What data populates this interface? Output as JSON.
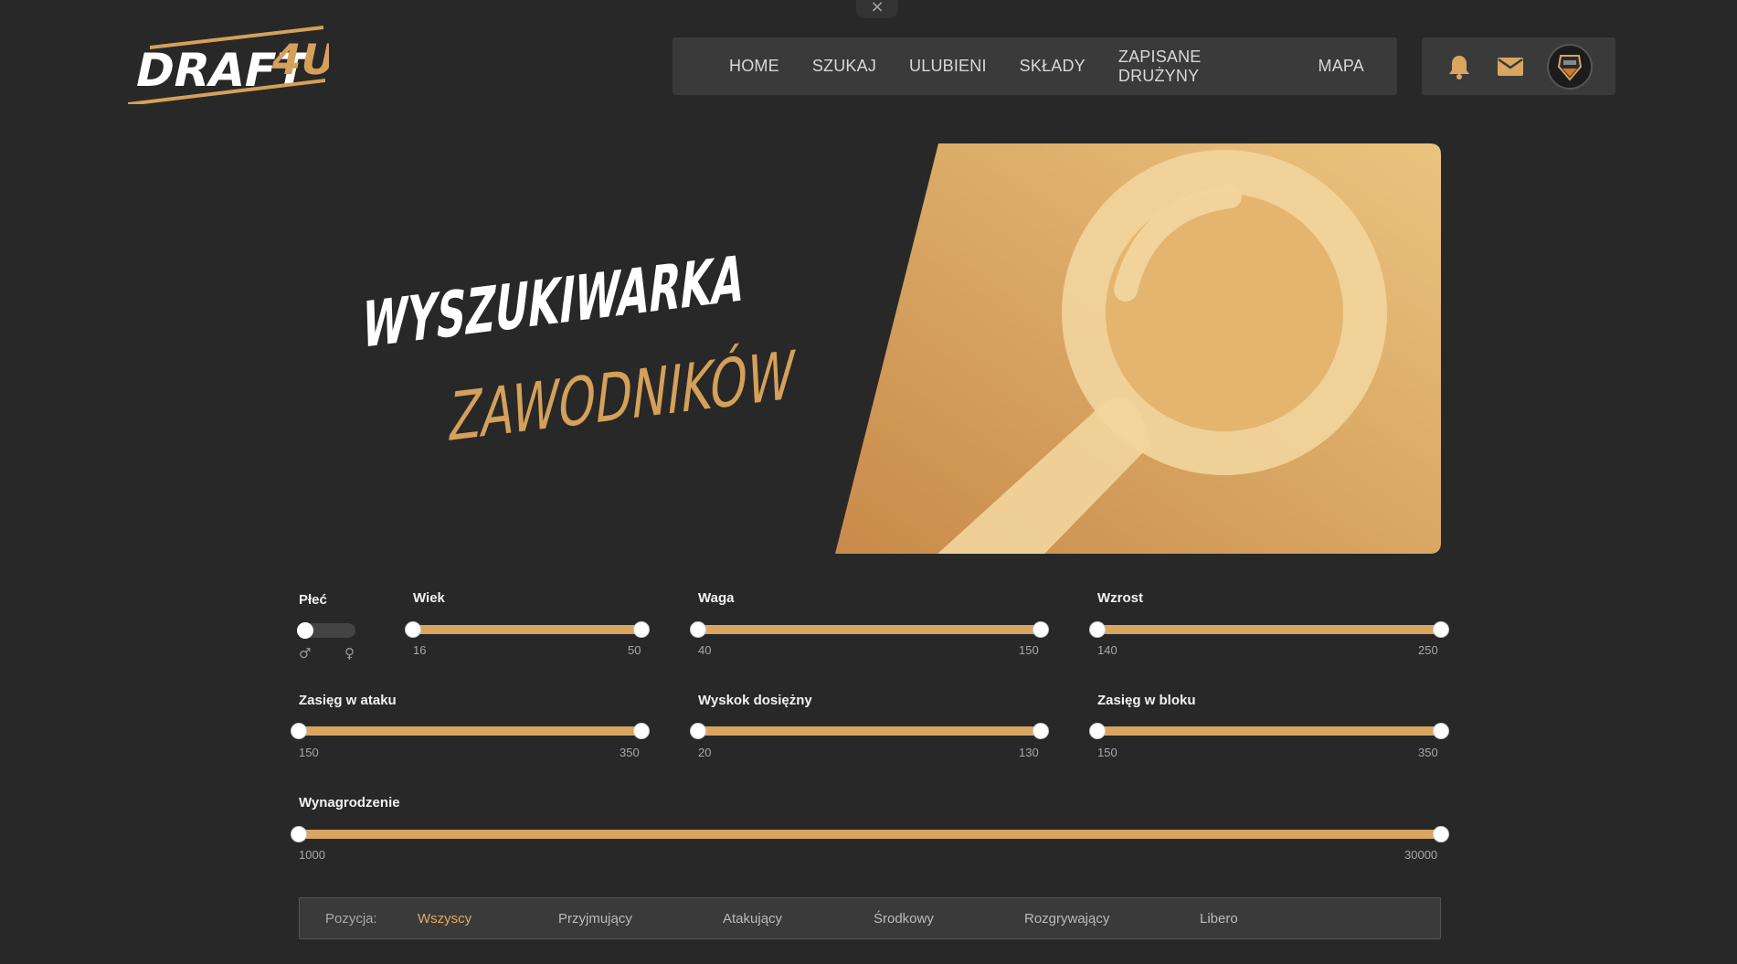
{
  "close_glyph": "×",
  "logo": {
    "text_left": "DRAFT",
    "text_accent": "4U",
    "accent": "#d4a05a"
  },
  "nav": {
    "items": [
      "HOME",
      "SZUKAJ",
      "ULUBIENI",
      "SKŁADY",
      "ZAPISANE DRUŻYNY",
      "MAPA"
    ]
  },
  "icons": {
    "notifications": "bell-icon",
    "messages": "envelope-icon",
    "avatar": "team-crest-avatar"
  },
  "hero": {
    "title_line1": "WYSZUKIWARKA",
    "title_line2": "ZAWODNIKÓW",
    "accent": "#d4a05a"
  },
  "filters": {
    "gender": {
      "label": "Płeć",
      "male_symbol": "♂",
      "female_symbol": "♀",
      "value": "male"
    },
    "age": {
      "label": "Wiek",
      "min": "16",
      "max": "50"
    },
    "weight": {
      "label": "Waga",
      "min": "40",
      "max": "150"
    },
    "height": {
      "label": "Wzrost",
      "min": "140",
      "max": "250"
    },
    "attack_reach": {
      "label": "Zasięg w ataku",
      "min": "150",
      "max": "350"
    },
    "jump_reach": {
      "label": "Wyskok dosiężny",
      "min": "20",
      "max": "130"
    },
    "block_reach": {
      "label": "Zasięg w bloku",
      "min": "150",
      "max": "350"
    },
    "salary": {
      "label": "Wynagrodzenie",
      "min": "1000",
      "max": "30000"
    }
  },
  "positions": {
    "label": "Pozycja:",
    "options": [
      "Wszyscy",
      "Przyjmujący",
      "Atakujący",
      "Środkowy",
      "Rozgrywający",
      "Libero"
    ],
    "selected": "Wszyscy"
  },
  "colors": {
    "background": "#282828",
    "panel": "#3a3a3a",
    "gold": "#d9a560"
  }
}
